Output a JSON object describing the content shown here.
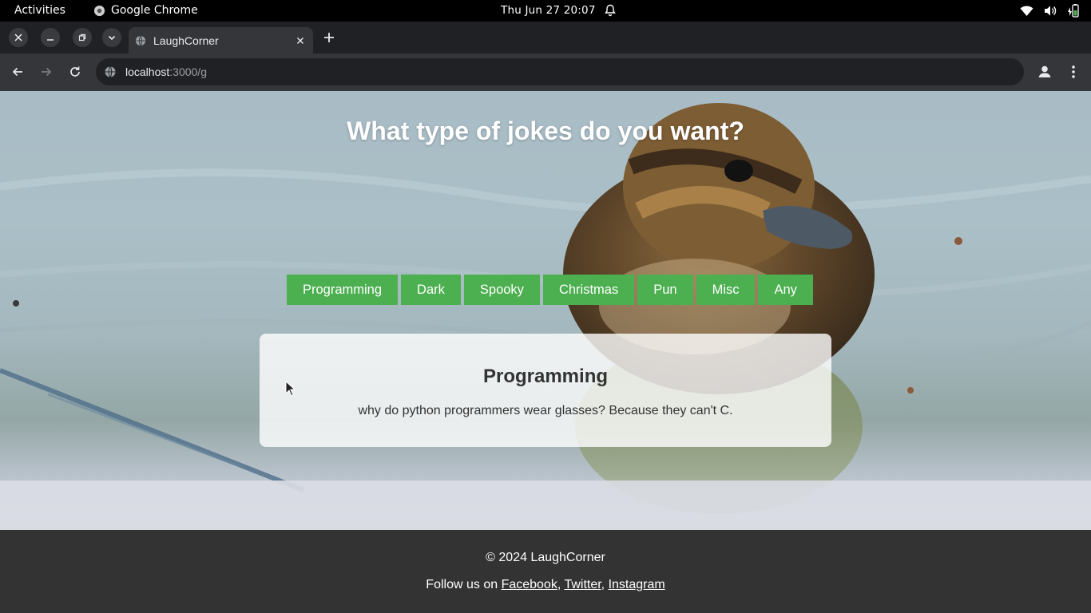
{
  "system": {
    "activities": "Activities",
    "app_name": "Google Chrome",
    "clock": "Thu Jun 27  20:07"
  },
  "browser": {
    "tab_title": "LaughCorner",
    "url_host": "localhost",
    "url_rest": ":3000/g"
  },
  "page": {
    "headline": "What type of jokes do you want?",
    "categories": [
      "Programming",
      "Dark",
      "Spooky",
      "Christmas",
      "Pun",
      "Misc",
      "Any"
    ],
    "joke": {
      "category": "Programming",
      "text": "why do python programmers wear glasses? Because they can't C."
    },
    "footer": {
      "copyright": "© 2024 LaughCorner",
      "follow_prefix": "Follow us on ",
      "links": [
        "Facebook",
        "Twitter",
        "Instagram"
      ],
      "sep1": ", ",
      "sep2": ", "
    }
  },
  "colors": {
    "button_green": "#4caf50",
    "footer_bg": "#333333"
  }
}
